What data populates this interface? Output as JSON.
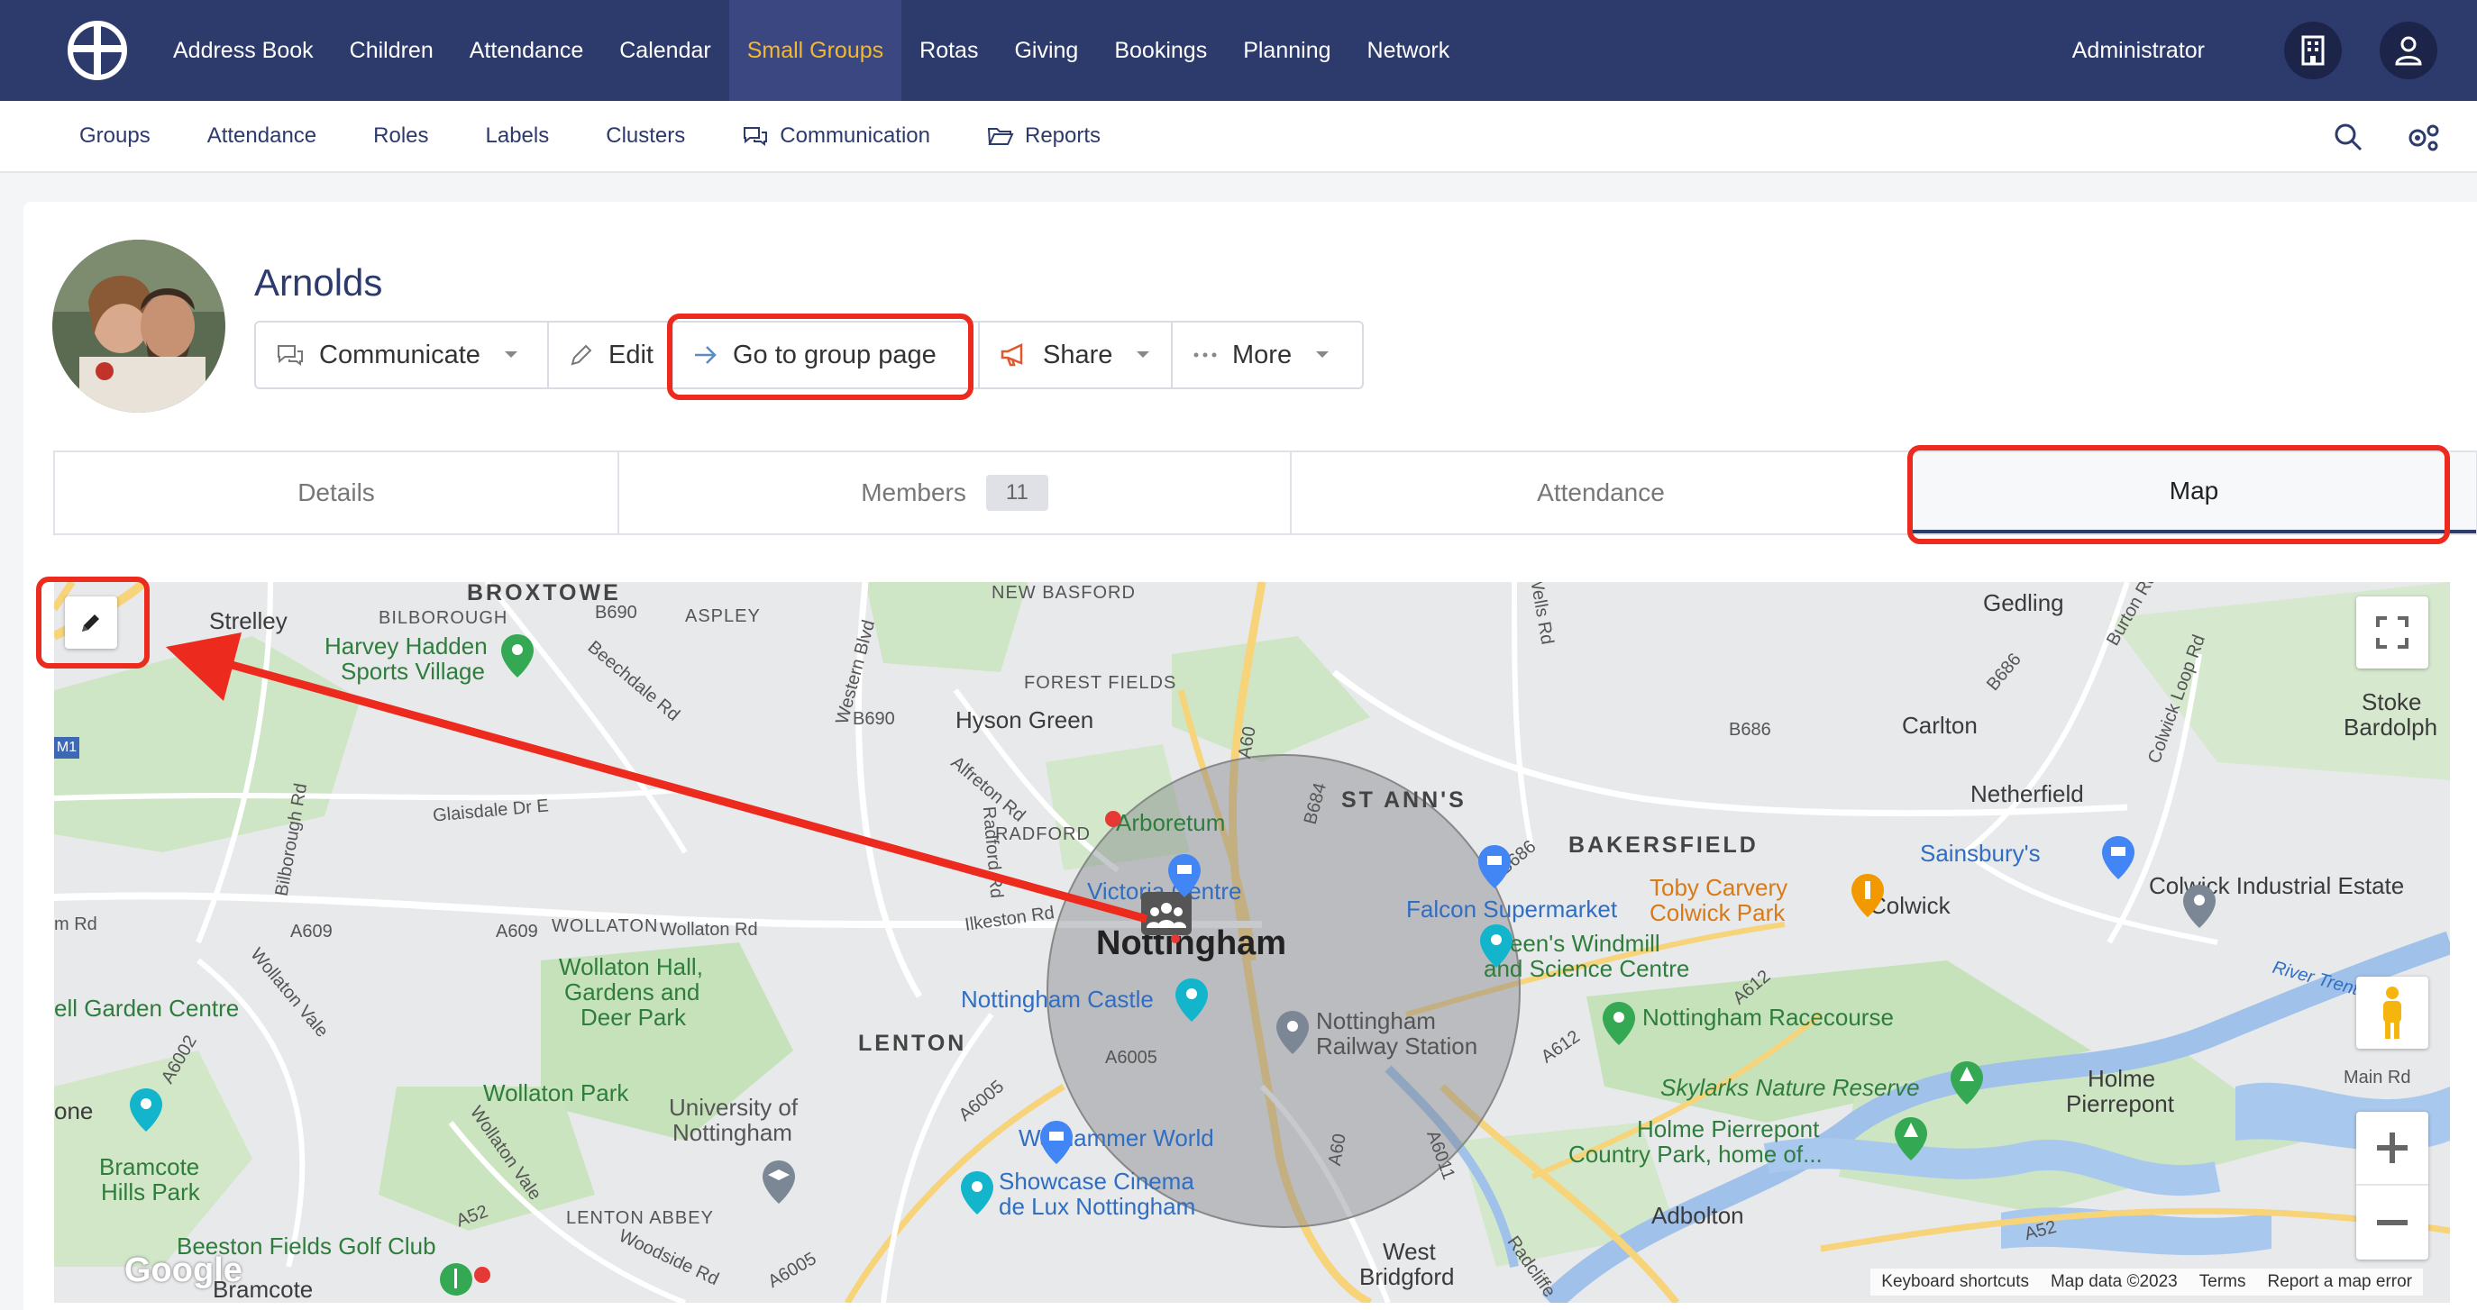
{
  "topnav": {
    "items": [
      "Address Book",
      "Children",
      "Attendance",
      "Calendar",
      "Small Groups",
      "Rotas",
      "Giving",
      "Bookings",
      "Planning",
      "Network"
    ],
    "active": "Small Groups",
    "user_label": "Administrator"
  },
  "subnav": {
    "items": [
      "Groups",
      "Attendance",
      "Roles",
      "Labels",
      "Clusters",
      "Communication",
      "Reports"
    ]
  },
  "group": {
    "title": "Arnolds",
    "buttons": {
      "communicate": "Communicate",
      "edit": "Edit",
      "goto": "Go to group page",
      "share": "Share",
      "more": "More"
    }
  },
  "tabs": {
    "details": "Details",
    "members": "Members",
    "members_count": "11",
    "attendance": "Attendance",
    "map": "Map"
  },
  "map": {
    "labels": {
      "broxtowe": "BROXTOWE",
      "strelley": "Strelley",
      "bilborough": "BILBOROUGH",
      "aspley": "ASPLEY",
      "new_basford": "NEW BASFORD",
      "gedling": "Gedling",
      "harvey": "Harvey Hadden",
      "harvey2": "Sports Village",
      "forest_fields": "FOREST FIELDS",
      "hyson_green": "Hyson Green",
      "carlton": "Carlton",
      "stoke": "Stoke",
      "bardolph": "Bardolph",
      "netherfield": "Netherfield",
      "radford": "RADFORD",
      "arboretum": "Arboretum",
      "st_anns": "ST ANN'S",
      "bakersfield": "BAKERSFIELD",
      "sainsburys": "Sainsbury's",
      "victoria": "Victoria Centre",
      "falcon": "Falcon Supermarket",
      "toby": "Toby Carvery",
      "toby2": "Colwick Park",
      "colwick": "Colwick",
      "colwick_ind": "Colwick Industrial Estate",
      "wollaton": "WOLLATON",
      "nottingham": "Nottingham",
      "greens": "Green's Windmill",
      "greens2": "and Science Centre",
      "wollaton_hall": "Wollaton Hall,",
      "wollaton_hall2": "Gardens and",
      "wollaton_hall3": "Deer Park",
      "garden_centre": "ell Garden Centre",
      "castle": "Nottingham Castle",
      "station": "Nottingham",
      "station2": "Railway Station",
      "racecourse": "Nottingham Racecourse",
      "lenton": "LENTON",
      "wollaton_park": "Wollaton Park",
      "skylarks": "Skylarks Nature Reserve",
      "holme": "Holme",
      "pierrepont": "Pierrepont",
      "university": "University of",
      "university2": "Nottingham",
      "warhammer": "Warhammer World",
      "holme_country": "Holme Pierrepont",
      "holme_country2": "Country Park, home of...",
      "bramcote_hills": "Bramcote",
      "bramcote_hills2": "Hills Park",
      "showcase": "Showcase Cinema",
      "showcase2": "de Lux Nottingham",
      "lenton_abbey": "LENTON ABBEY",
      "adbolton": "Adbolton",
      "beeston": "Beeston Fields Golf Club",
      "west": "West",
      "bridgford": "Bridgford",
      "bramcote": "Bramcote",
      "one": "one"
    },
    "roads": [
      "B690",
      "B690",
      "Beechdale Rd",
      "Western Blvd",
      "B686",
      "B686",
      "A60",
      "B684",
      "Glaisdale Dr E",
      "Bilborough Rd",
      "Alfreton Rd",
      "Radford Rd",
      "B686",
      "Colwick Loop Rd",
      "A609",
      "A609",
      "Wollaton Rd",
      "Ilkeston Rd",
      "m Rd",
      "Wollaton Vale",
      "A6002",
      "A612",
      "A612",
      "A6005",
      "A6005",
      "A6005",
      "Wollaton Vale",
      "A60",
      "A6011",
      "A52",
      "A52",
      "Woodside Rd",
      "Main Rd",
      "Burton Rd",
      "Wells Rd",
      "River Trent",
      "Radcliffe"
    ],
    "footer": {
      "shortcuts": "Keyboard shortcuts",
      "mapdata": "Map data ©2023",
      "terms": "Terms",
      "report": "Report a map error"
    },
    "google": "Google"
  }
}
